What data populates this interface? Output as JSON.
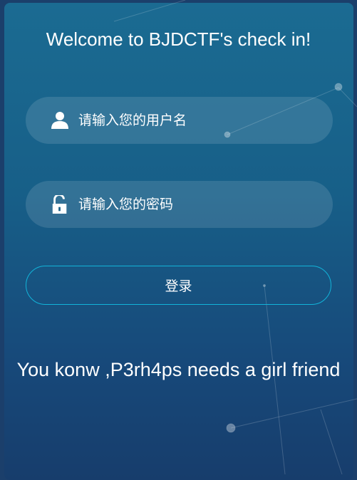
{
  "title": "Welcome to BJDCTF's check in!",
  "username": {
    "placeholder": "请输入您的用户名",
    "value": "",
    "icon": "user-icon"
  },
  "password": {
    "placeholder": "请输入您的密码",
    "value": "",
    "icon": "unlock-icon"
  },
  "login_label": "登录",
  "message": "You konw ,P3rh4ps needs a girl friend",
  "colors": {
    "accent": "#12b4d9",
    "background_top": "#1b6b92",
    "background_bottom": "#173d6c"
  }
}
